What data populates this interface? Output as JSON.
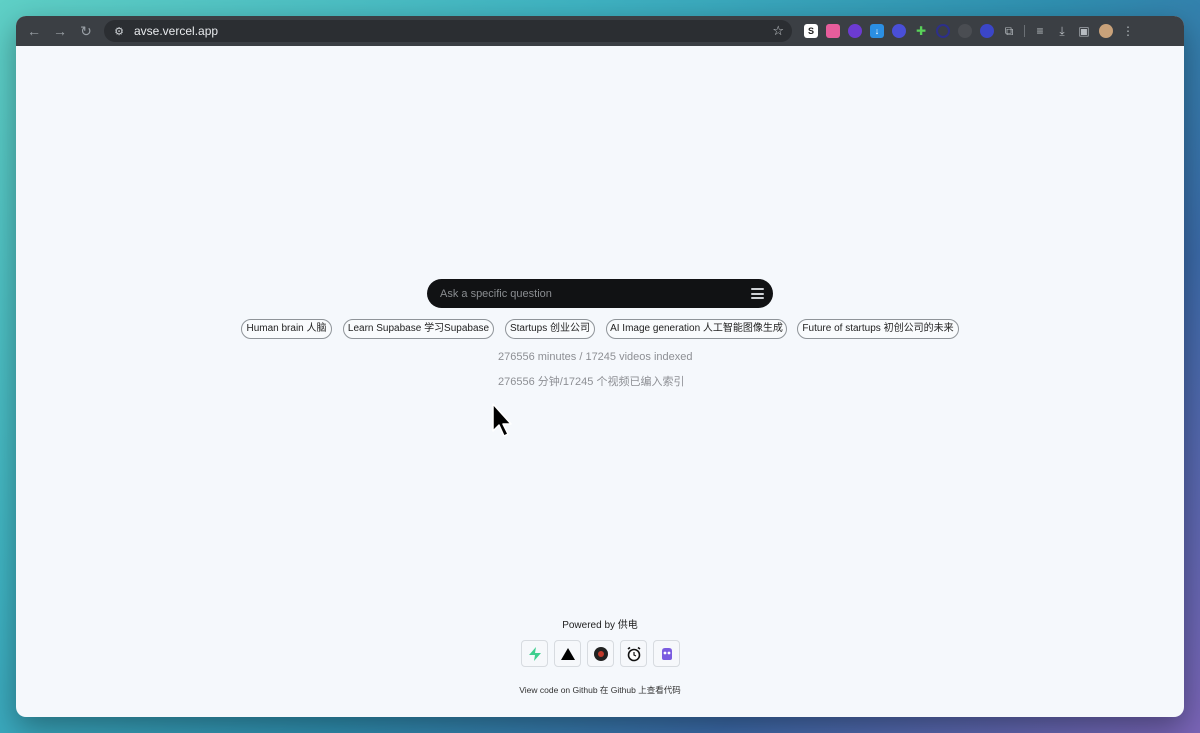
{
  "browser": {
    "url": "avse.vercel.app",
    "extensions": [
      {
        "name": "s-extension-icon",
        "glyph": "S",
        "color": "#ffffff",
        "text_color": "#1c1c1c"
      },
      {
        "name": "colorful-extension-icon",
        "glyph": "",
        "color": "#e85d9c",
        "text_color": "#ffffff"
      },
      {
        "name": "panda-extension-icon",
        "glyph": "",
        "color": "#6c3bd1",
        "text_color": "#ffffff"
      },
      {
        "name": "download-extension-icon",
        "glyph": "↓",
        "color": "#2b8fe3",
        "text_color": "#ffffff"
      },
      {
        "name": "globe-extension-icon",
        "glyph": "",
        "color": "#4a4fd8",
        "text_color": "#ffffff"
      },
      {
        "name": "leaf-extension-icon",
        "glyph": "✚",
        "color": "#2a7a2a",
        "text_color": "#59d259"
      },
      {
        "name": "ring-extension-icon",
        "glyph": "",
        "color": "#2d2f8a",
        "text_color": "#ffffff"
      },
      {
        "name": "dark-extension-icon",
        "glyph": "",
        "color": "#4a4d52",
        "text_color": "#ffffff"
      },
      {
        "name": "network-extension-icon",
        "glyph": "",
        "color": "#3b46c8",
        "text_color": "#ffffff"
      }
    ]
  },
  "search": {
    "placeholder": "Ask a specific question"
  },
  "chips": [
    {
      "label": "Human brain 人脑"
    },
    {
      "label": "Learn Supabase 学习Supabase"
    },
    {
      "label": "Startups 创业公司"
    },
    {
      "label": "AI Image generation 人工智能图像生成"
    },
    {
      "label": "Future of startups 初创公司的未来"
    }
  ],
  "stats": {
    "english": "276556 minutes / 17245 videos indexed",
    "chinese": "276556 分钟/17245 个视频已编入索引"
  },
  "footer": {
    "powered_by": "Powered by 供电",
    "github": "View code on Github 在 Github 上查看代码",
    "sponsors": [
      {
        "name": "supabase-logo-icon"
      },
      {
        "name": "vercel-logo-icon"
      },
      {
        "name": "record-logo-icon"
      },
      {
        "name": "alarm-clock-logo-icon"
      },
      {
        "name": "purple-brain-logo-icon"
      }
    ]
  },
  "colors": {
    "page_background": "#f5f8fc",
    "search_background": "#111214",
    "chip_border": "#8f9499",
    "stats_text": "#8d8f94",
    "supabase_green": "#3ecf8e"
  }
}
